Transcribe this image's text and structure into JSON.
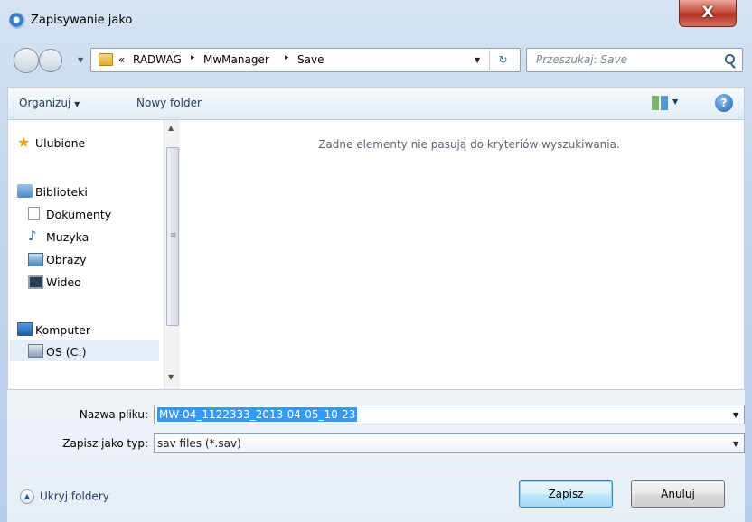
{
  "window": {
    "title": "Zapisywanie jako",
    "close_label": "X"
  },
  "address": {
    "crumbs": [
      "«",
      "RADWAG",
      "MwManager",
      "Save"
    ],
    "separator": "▸"
  },
  "search": {
    "placeholder": "Przeszukaj: Save"
  },
  "toolbar": {
    "organize_label": "Organizuj",
    "new_folder_label": "Nowy folder",
    "help_label": "?"
  },
  "sidebar": {
    "items": [
      {
        "label": "Ulubione",
        "icon": "star-icon"
      },
      {
        "label": "Biblioteki",
        "icon": "libraries-icon"
      },
      {
        "label": "Dokumenty",
        "icon": "documents-icon"
      },
      {
        "label": "Muzyka",
        "icon": "music-icon"
      },
      {
        "label": "Obrazy",
        "icon": "pictures-icon"
      },
      {
        "label": "Wideo",
        "icon": "video-icon"
      },
      {
        "label": "Komputer",
        "icon": "computer-icon"
      },
      {
        "label": "OS (C:)",
        "icon": "drive-icon"
      }
    ]
  },
  "content": {
    "empty_message": "Zadne elementy nie pasują do kryteriów wyszukiwania."
  },
  "form": {
    "filename_label": "Nazwa pliku:",
    "filename_value": "MW-04_1122333_2013-04-05_10-23",
    "filetype_label": "Zapisz jako typ:",
    "filetype_value": "sav files (*.sav)"
  },
  "footer": {
    "hide_folders_label": "Ukryj foldery",
    "save_label": "Zapisz",
    "cancel_label": "Anuluj"
  },
  "colors": {
    "selection": "#3399ff",
    "accent": "#1e395b",
    "close": "#c8503e"
  }
}
